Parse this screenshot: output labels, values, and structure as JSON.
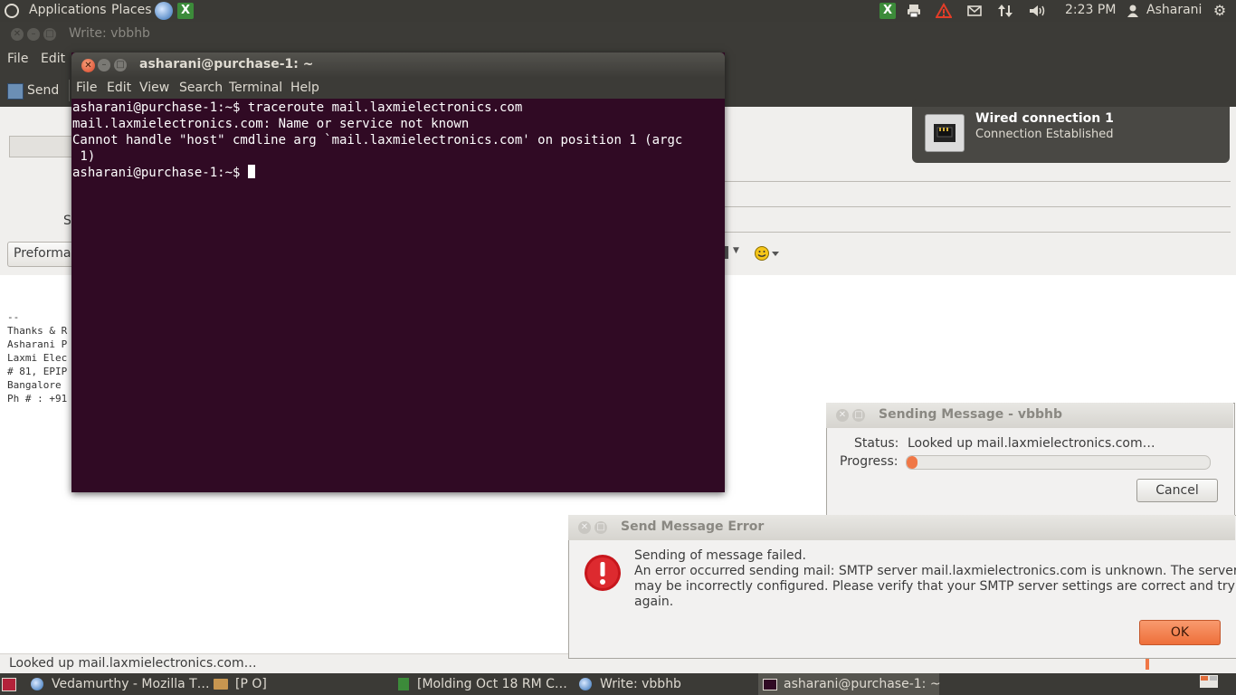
{
  "top_panel": {
    "applications_label": "Applications",
    "places_label": "Places",
    "xls_label": "X",
    "time": "2:23 PM",
    "user": "Asharani"
  },
  "compose": {
    "window_title": "Write: vbbhb",
    "menu": [
      "File",
      "Edit"
    ],
    "send_label": "Send",
    "subject_letter": "S",
    "format_label": "Preforma",
    "signature_lines": [
      "--",
      "Thanks & R",
      "Asharani P",
      "Laxmi Elec",
      "# 81, EPIP",
      "Bangalore ",
      "Ph # : +91"
    ],
    "status_text": "Looked up mail.laxmielectronics.com…"
  },
  "terminal": {
    "title": "asharani@purchase-1: ~",
    "menu": [
      "File",
      "Edit",
      "View",
      "Search",
      "Terminal",
      "Help"
    ],
    "lines": [
      "asharani@purchase-1:~$ traceroute mail.laxmielectronics.com",
      "mail.laxmielectronics.com: Name or service not known",
      "Cannot handle \"host\" cmdline arg `mail.laxmielectronics.com' on position 1 (argc",
      " 1)"
    ],
    "prompt": "asharani@purchase-1:~$ "
  },
  "notification": {
    "title": "Wired connection 1",
    "body": "Connection Established"
  },
  "sending_dialog": {
    "title": "Sending Message - vbbhb",
    "status_label": "Status:",
    "status_value": "Looked up mail.laxmielectronics.com…",
    "progress_label": "Progress:",
    "progress_fraction": 0.02,
    "cancel_label": "Cancel"
  },
  "error_dialog": {
    "title": "Send Message Error",
    "heading": "Sending of message failed.",
    "message_lines": [
      "An error occurred sending mail: SMTP server mail.laxmielectronics.com is unknown. The server",
      "may be incorrectly configured. Please verify that your SMTP server settings are correct and try",
      "again."
    ],
    "ok_label": "OK"
  },
  "taskbar": {
    "items": [
      {
        "label": "Vedamurthy - Mozilla T…"
      },
      {
        "label": "[P O]"
      },
      {
        "label": "[Molding Oct 18 RM  C…"
      },
      {
        "label": "Write: vbbhb"
      },
      {
        "label": "asharani@purchase-1: ~"
      }
    ]
  },
  "colors": {
    "panel": "#3b3a36",
    "terminal_bg": "#300a24",
    "accent_orange": "#f07746",
    "error_red": "#c7161c"
  }
}
